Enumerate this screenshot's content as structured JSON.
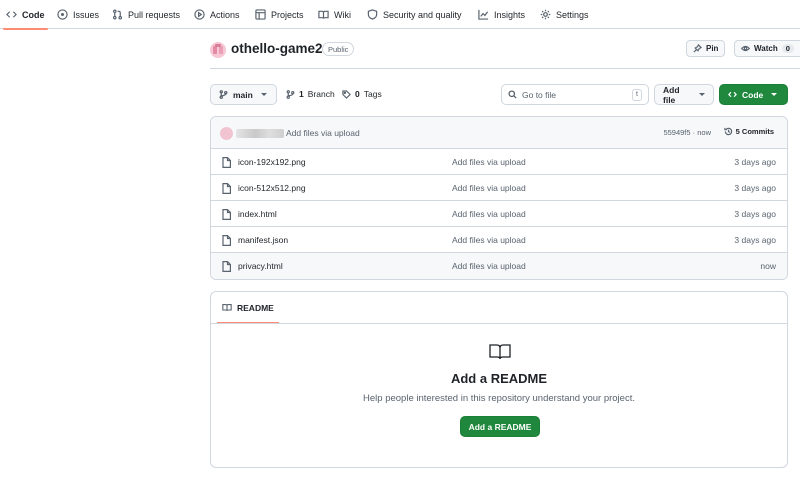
{
  "nav": {
    "tabs": [
      {
        "label": "Code",
        "icon": "code-icon"
      },
      {
        "label": "Issues",
        "icon": "issue-icon"
      },
      {
        "label": "Pull requests",
        "icon": "pull-request-icon"
      },
      {
        "label": "Actions",
        "icon": "play-icon"
      },
      {
        "label": "Projects",
        "icon": "table-icon"
      },
      {
        "label": "Wiki",
        "icon": "book-icon"
      },
      {
        "label": "Security and quality",
        "icon": "shield-icon"
      },
      {
        "label": "Insights",
        "icon": "graph-icon"
      },
      {
        "label": "Settings",
        "icon": "gear-icon"
      }
    ],
    "active_tab": "Code"
  },
  "repo": {
    "name": "othello-game2",
    "visibility": "Public",
    "pin_label": "Pin",
    "watch_label": "Watch",
    "watch_count": "0"
  },
  "toolbar": {
    "branch": "main",
    "branch_count": "1",
    "branch_label": "Branch",
    "tag_count": "0",
    "tag_label": "Tags",
    "search_placeholder": "Go to file",
    "search_shortcut": "t",
    "add_file_label": "Add file",
    "code_label": "Code"
  },
  "latest_commit": {
    "message": "Add files via upload",
    "hash_time": "55949f5 · now",
    "commits_label": "5 Commits"
  },
  "files": [
    {
      "name": "icon-192x192.png",
      "message": "Add files via upload",
      "date": "3 days ago"
    },
    {
      "name": "icon-512x512.png",
      "message": "Add files via upload",
      "date": "3 days ago"
    },
    {
      "name": "index.html",
      "message": "Add files via upload",
      "date": "3 days ago"
    },
    {
      "name": "manifest.json",
      "message": "Add files via upload",
      "date": "3 days ago"
    },
    {
      "name": "privacy.html",
      "message": "Add files via upload",
      "date": "now"
    }
  ],
  "readme": {
    "tab_label": "README",
    "title": "Add a README",
    "description": "Help people interested in this repository understand your project.",
    "button_label": "Add a README"
  },
  "colors": {
    "accent_underline": "#fd8c73",
    "primary_green": "#1f883d",
    "border": "#d0d7de",
    "muted_text": "#59636e"
  }
}
